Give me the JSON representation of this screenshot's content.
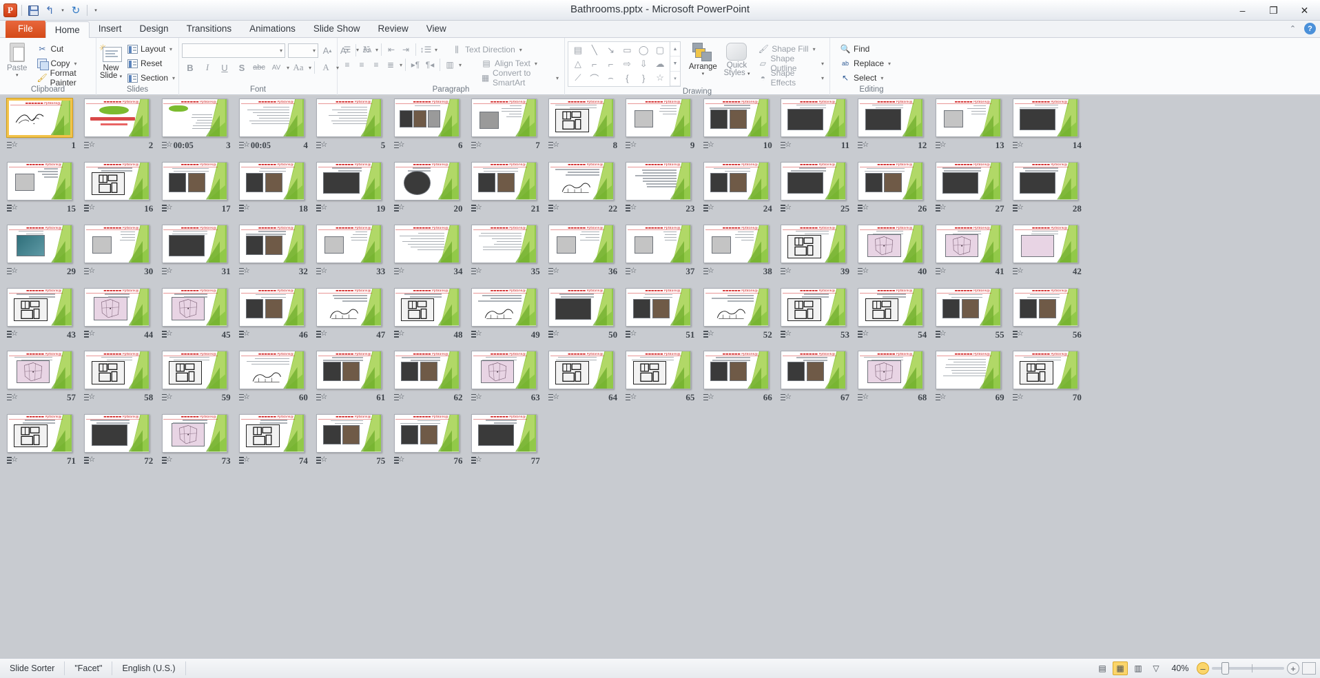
{
  "window": {
    "title": "Bathrooms.pptx  -  Microsoft PowerPoint",
    "minimize": "–",
    "restore": "❐",
    "close": "✕"
  },
  "quick_access": {
    "app_icon": "P",
    "save": "save-icon",
    "undo": "↰",
    "undo_caret": "▾",
    "redo": "↻",
    "customize": "▾"
  },
  "help_icons": {
    "minimize_ribbon": "⌃",
    "help": "?"
  },
  "tabs": [
    {
      "label": "File",
      "type": "file"
    },
    {
      "label": "Home",
      "type": "active"
    },
    {
      "label": "Insert",
      "type": "normal"
    },
    {
      "label": "Design",
      "type": "normal"
    },
    {
      "label": "Transitions",
      "type": "normal"
    },
    {
      "label": "Animations",
      "type": "normal"
    },
    {
      "label": "Slide Show",
      "type": "normal"
    },
    {
      "label": "Review",
      "type": "normal"
    },
    {
      "label": "View",
      "type": "normal"
    }
  ],
  "ribbon": {
    "clipboard": {
      "label": "Clipboard",
      "paste": "Paste",
      "paste_caret": "▾",
      "cut": "Cut",
      "copy": "Copy",
      "copy_caret": "▾",
      "format_painter": "Format Painter"
    },
    "slides": {
      "label": "Slides",
      "new_slide": "New\nSlide",
      "new_slide_line1": "New",
      "new_slide_line2": "Slide",
      "new_slide_caret": "▾",
      "layout": "Layout",
      "layout_caret": "▾",
      "reset": "Reset",
      "section": "Section",
      "section_caret": "▾"
    },
    "font": {
      "label": "Font",
      "font_name": "",
      "font_size": "",
      "grow": "A",
      "shrink": "A",
      "clear_formatting": "Aa",
      "bold": "B",
      "italic": "I",
      "underline": "U",
      "shadow": "S",
      "strikethrough": "abc",
      "character_spacing": "AV",
      "change_case": "Aa",
      "font_color": "A"
    },
    "paragraph": {
      "label": "Paragraph",
      "text_direction": "Text Direction",
      "align_text": "Align Text",
      "convert_smartart": "Convert to SmartArt"
    },
    "drawing": {
      "label": "Drawing",
      "arrange": "Arrange",
      "quick_styles_line1": "Quick",
      "quick_styles_line2": "Styles",
      "shape_fill": "Shape Fill",
      "shape_outline": "Shape Outline",
      "shape_effects": "Shape Effects"
    },
    "editing": {
      "label": "Editing",
      "find": "Find",
      "replace": "Replace",
      "select": "Select"
    }
  },
  "status_bar": {
    "view_name": "Slide Sorter",
    "theme": "\"Facet\"",
    "language": "English (U.S.)",
    "zoom_level": "40%",
    "zoom_out": "–",
    "zoom_in": "+",
    "views": [
      {
        "name": "normal-view",
        "glyph": "▤"
      },
      {
        "name": "slide-sorter-view",
        "glyph": "▦",
        "active": true
      },
      {
        "name": "reading-view",
        "glyph": "▥"
      },
      {
        "name": "slide-show-view",
        "glyph": "▽"
      }
    ]
  },
  "sorter": {
    "selected_slide": 1,
    "total_slides": 77,
    "columns": 14,
    "watermark": "@PptBank",
    "slides": [
      {
        "n": 1,
        "kind": "calligraphy",
        "timing": "",
        "selected": true
      },
      {
        "n": 2,
        "kind": "title",
        "timing": ""
      },
      {
        "n": 3,
        "kind": "cloud-text",
        "timing": "00:05"
      },
      {
        "n": 4,
        "kind": "text",
        "timing": "00:05"
      },
      {
        "n": 5,
        "kind": "text",
        "timing": ""
      },
      {
        "n": 6,
        "kind": "photo-row3",
        "timing": ""
      },
      {
        "n": 7,
        "kind": "photo-text",
        "timing": ""
      },
      {
        "n": 8,
        "kind": "plan-dark",
        "timing": ""
      },
      {
        "n": 9,
        "kind": "photo-small",
        "timing": ""
      },
      {
        "n": 10,
        "kind": "photo-pair",
        "timing": ""
      },
      {
        "n": 11,
        "kind": "photo-wide",
        "timing": ""
      },
      {
        "n": 12,
        "kind": "photo-wide",
        "timing": ""
      },
      {
        "n": 13,
        "kind": "photo-small",
        "timing": ""
      },
      {
        "n": 14,
        "kind": "photo-wide",
        "timing": ""
      },
      {
        "n": 15,
        "kind": "photo-small",
        "timing": ""
      },
      {
        "n": 16,
        "kind": "plan-dark",
        "timing": ""
      },
      {
        "n": 17,
        "kind": "photo-pair",
        "timing": ""
      },
      {
        "n": 18,
        "kind": "photo-pair",
        "timing": ""
      },
      {
        "n": 19,
        "kind": "photo-wide",
        "timing": ""
      },
      {
        "n": 20,
        "kind": "dome-photo",
        "timing": ""
      },
      {
        "n": 21,
        "kind": "photo-pair",
        "timing": ""
      },
      {
        "n": 22,
        "kind": "sketch",
        "timing": ""
      },
      {
        "n": 23,
        "kind": "text",
        "timing": ""
      },
      {
        "n": 24,
        "kind": "photo-pair",
        "timing": ""
      },
      {
        "n": 25,
        "kind": "photo-wide",
        "timing": ""
      },
      {
        "n": 26,
        "kind": "photo-pair",
        "timing": ""
      },
      {
        "n": 27,
        "kind": "photo-wide",
        "timing": ""
      },
      {
        "n": 28,
        "kind": "photo-wide",
        "timing": ""
      },
      {
        "n": 29,
        "kind": "tile-photo",
        "timing": ""
      },
      {
        "n": 30,
        "kind": "photo-small",
        "timing": ""
      },
      {
        "n": 31,
        "kind": "photo-wide",
        "timing": ""
      },
      {
        "n": 32,
        "kind": "photo-pair",
        "timing": ""
      },
      {
        "n": 33,
        "kind": "photo-small",
        "timing": ""
      },
      {
        "n": 34,
        "kind": "text",
        "timing": ""
      },
      {
        "n": 35,
        "kind": "text",
        "timing": ""
      },
      {
        "n": 36,
        "kind": "photo-small",
        "timing": ""
      },
      {
        "n": 37,
        "kind": "photo-small",
        "timing": ""
      },
      {
        "n": 38,
        "kind": "photo-small",
        "timing": ""
      },
      {
        "n": 39,
        "kind": "plan-dark",
        "timing": ""
      },
      {
        "n": 40,
        "kind": "plan-pink",
        "timing": ""
      },
      {
        "n": 41,
        "kind": "plan-pink",
        "timing": ""
      },
      {
        "n": 42,
        "kind": "photo-pink",
        "timing": ""
      },
      {
        "n": 43,
        "kind": "plan-dark",
        "timing": ""
      },
      {
        "n": 44,
        "kind": "plan-pink",
        "timing": ""
      },
      {
        "n": 45,
        "kind": "plan-pink",
        "timing": ""
      },
      {
        "n": 46,
        "kind": "photo-pair",
        "timing": ""
      },
      {
        "n": 47,
        "kind": "sketch",
        "timing": ""
      },
      {
        "n": 48,
        "kind": "plan-dark",
        "timing": ""
      },
      {
        "n": 49,
        "kind": "sketch",
        "timing": ""
      },
      {
        "n": 50,
        "kind": "photo-wide",
        "timing": ""
      },
      {
        "n": 51,
        "kind": "photo-pair",
        "timing": ""
      },
      {
        "n": 52,
        "kind": "sketch",
        "timing": ""
      },
      {
        "n": 53,
        "kind": "plan-dark",
        "timing": ""
      },
      {
        "n": 54,
        "kind": "plan-dark",
        "timing": ""
      },
      {
        "n": 55,
        "kind": "photo-pair",
        "timing": ""
      },
      {
        "n": 56,
        "kind": "photo-pair",
        "timing": ""
      },
      {
        "n": 57,
        "kind": "plan-pink",
        "timing": ""
      },
      {
        "n": 58,
        "kind": "plan-dark",
        "timing": ""
      },
      {
        "n": 59,
        "kind": "plan-dark",
        "timing": ""
      },
      {
        "n": 60,
        "kind": "sketch",
        "timing": ""
      },
      {
        "n": 61,
        "kind": "photo-pair",
        "timing": ""
      },
      {
        "n": 62,
        "kind": "photo-pair",
        "timing": ""
      },
      {
        "n": 63,
        "kind": "plan-pink",
        "timing": ""
      },
      {
        "n": 64,
        "kind": "plan-dark",
        "timing": ""
      },
      {
        "n": 65,
        "kind": "plan-dark",
        "timing": ""
      },
      {
        "n": 66,
        "kind": "photo-pair",
        "timing": ""
      },
      {
        "n": 67,
        "kind": "photo-pair",
        "timing": ""
      },
      {
        "n": 68,
        "kind": "plan-pink",
        "timing": ""
      },
      {
        "n": 69,
        "kind": "text",
        "timing": ""
      },
      {
        "n": 70,
        "kind": "plan-dark",
        "timing": ""
      },
      {
        "n": 71,
        "kind": "plan-dark",
        "timing": ""
      },
      {
        "n": 72,
        "kind": "photo-wide",
        "timing": ""
      },
      {
        "n": 73,
        "kind": "plan-pink",
        "timing": ""
      },
      {
        "n": 74,
        "kind": "plan-dark",
        "timing": ""
      },
      {
        "n": 75,
        "kind": "photo-pair",
        "timing": ""
      },
      {
        "n": 76,
        "kind": "photo-pair",
        "timing": ""
      },
      {
        "n": 77,
        "kind": "photo-wide",
        "timing": ""
      }
    ]
  }
}
